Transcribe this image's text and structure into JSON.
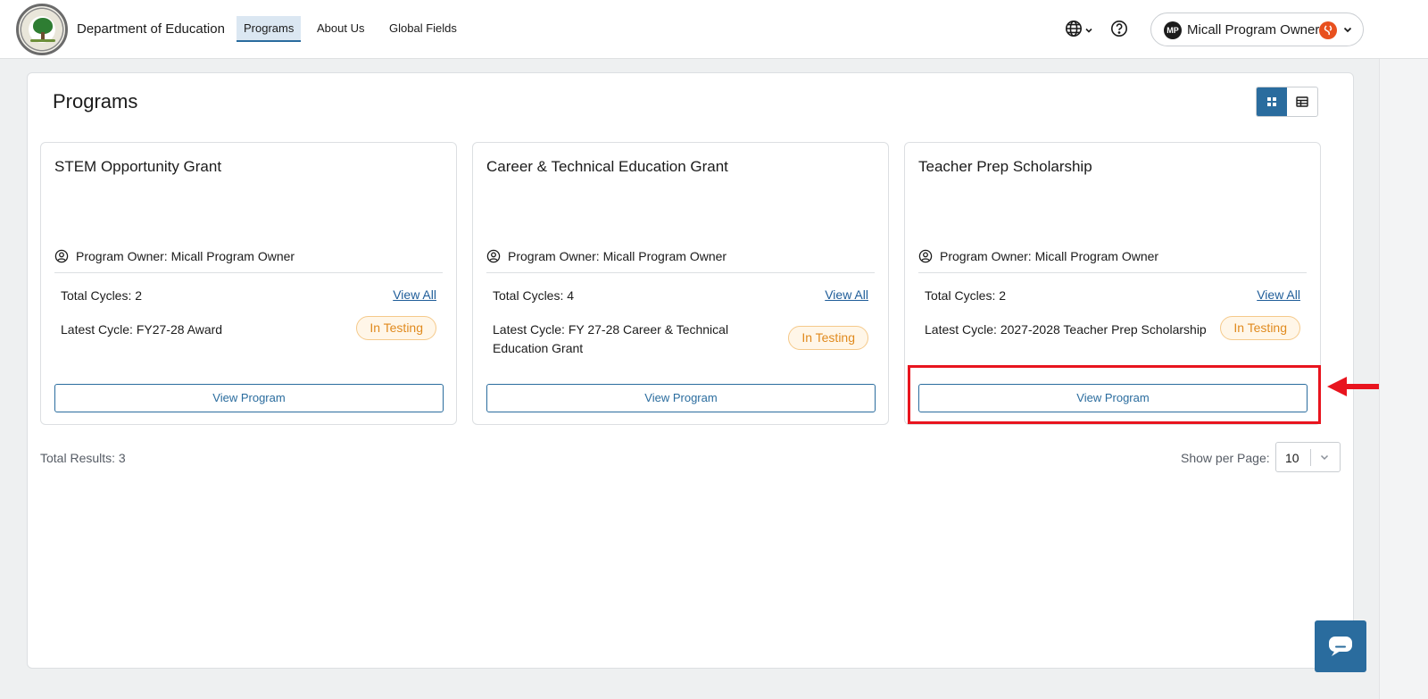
{
  "header": {
    "brand": "Department of Education",
    "nav": [
      {
        "label": "Programs",
        "active": true
      },
      {
        "label": "About Us",
        "active": false
      },
      {
        "label": "Global Fields",
        "active": false
      }
    ],
    "icons": [
      "globe-icon",
      "help-icon",
      "chevron-down-icon"
    ],
    "user": {
      "initials": "MP",
      "name": "Micall Program Owner"
    }
  },
  "page": {
    "title": "Programs",
    "view_modes": [
      "grid-view-icon",
      "table-view-icon"
    ],
    "active_view": "grid"
  },
  "cards": [
    {
      "title": "STEM Opportunity Grant",
      "owner": "Program Owner: Micall Program Owner",
      "total_cycles": "Total Cycles: 2",
      "view_all": "View All",
      "latest_cycle": "Latest Cycle: FY27-28 Award",
      "status": "In Testing",
      "button": "View Program"
    },
    {
      "title": "Career & Technical Education Grant",
      "owner": "Program Owner: Micall Program Owner",
      "total_cycles": "Total Cycles: 4",
      "view_all": "View All",
      "latest_cycle": "Latest Cycle: FY 27-28 Career & Technical Education Grant",
      "status": "In Testing",
      "button": "View Program"
    },
    {
      "title": "Teacher Prep Scholarship",
      "owner": "Program Owner: Micall Program Owner",
      "total_cycles": "Total Cycles: 2",
      "view_all": "View All",
      "latest_cycle": "Latest Cycle: 2027-2028 Teacher Prep Scholarship",
      "status": "In Testing",
      "button": "View Program"
    }
  ],
  "footer": {
    "total_results": "Total Results: 3",
    "per_page_label": "Show per Page:",
    "per_page_value": "10"
  },
  "colors": {
    "primary": "#2a6c9e",
    "badge_text": "#e08a1e",
    "badge_bg": "#fff6e8",
    "annotation": "#e8141e"
  }
}
